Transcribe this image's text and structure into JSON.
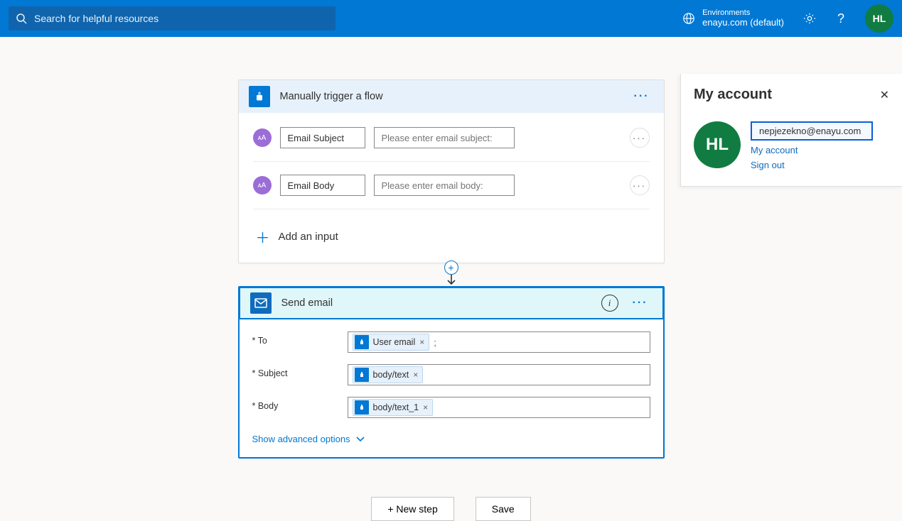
{
  "topbar": {
    "search_placeholder": "Search for helpful resources",
    "env_label": "Environments",
    "env_value": "enayu.com (default)",
    "avatar_initials": "HL"
  },
  "trigger_card": {
    "title": "Manually trigger a flow",
    "inputs": [
      {
        "label": "Email Subject",
        "placeholder": "Please enter email subject:"
      },
      {
        "label": "Email Body",
        "placeholder": "Please enter email body:"
      }
    ],
    "add_input_label": "Add an input"
  },
  "send_card": {
    "title": "Send email",
    "fields": {
      "to": {
        "label": "* To",
        "tokens": [
          "User email"
        ],
        "trailing": ";"
      },
      "subject": {
        "label": "* Subject",
        "tokens": [
          "body/text"
        ]
      },
      "body": {
        "label": "* Body",
        "tokens": [
          "body/text_1"
        ]
      }
    },
    "advanced_label": "Show advanced options"
  },
  "footer": {
    "new_step": "+ New step",
    "save": "Save"
  },
  "account_panel": {
    "title": "My account",
    "avatar_initials": "HL",
    "email": "nepjezekno@enayu.com",
    "my_account_link": "My account",
    "sign_out_link": "Sign out"
  }
}
